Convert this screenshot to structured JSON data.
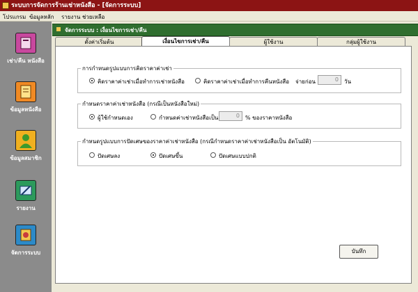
{
  "window": {
    "title": "ระบบการจัดการร้านเช่าหนังสือ - [จัดการระบบ]"
  },
  "menu": [
    "โปรแกรม",
    "ข้อมูลหลัก",
    "รายงาน",
    "ช่วยเหลือ"
  ],
  "sidebar": {
    "items": [
      {
        "label": "เช่า/คืน หนังสือ",
        "icon": "book-return-icon"
      },
      {
        "label": "ข้อมูลหนังสือ",
        "icon": "book-icon"
      },
      {
        "label": "ข้อมูลสมาชิก",
        "icon": "user-icon"
      },
      {
        "label": "รายงาน",
        "icon": "report-icon"
      },
      {
        "label": "จัดการระบบ",
        "icon": "settings-icon"
      }
    ]
  },
  "panel": {
    "title": "จัดการระบบ : เงื่อนไขการเช่า/คืน"
  },
  "tabs": [
    {
      "label": "ตั้งค่าเริ่มต้น",
      "active": false
    },
    {
      "label": "เงื่อนไขการเช่า/คืน",
      "active": true
    },
    {
      "label": "ผู้ใช้งาน",
      "active": false
    },
    {
      "label": "กลุ่มผู้ใช้งาน",
      "active": false
    }
  ],
  "groups": {
    "pricing": {
      "legend": "การกำหนดรูปแบบการคิดราคาค่าเช่า",
      "opt1": "คิดราคาค่าเช่าเมื่อทำการเช่าหนังสือ",
      "opt2": "คิดราคาค่าเช่าเมื่อทำการคืนหนังสือ",
      "prefix": "จ่ายก่อน",
      "days": "0",
      "suffix": "วัน",
      "selected": 1
    },
    "rent": {
      "legend": "กำหนดราคาค่าเช่าหนังสือ (กรณีเป็นหนังสือใหม่)",
      "opt1": "ผู้ใช้กำหนดเอง",
      "opt2": "กำหนดค่าเช่าหนังสือเป็น",
      "percent": "0",
      "suffix": "% ของราคาหนังสือ",
      "selected": 1
    },
    "rounding": {
      "legend": "กำหนดรูปแบบการปัดเศษของราคาค่าเช่าหนังสือ (กรณีกำหนดราคาค่าเช่าหนังสือเป็น อัตโนมัติ)",
      "opt1": "ปัดเศษลง",
      "opt2": "ปัดเศษขึ้น",
      "opt3": "ปัดเศษแบบปกติ",
      "selected": 2
    }
  },
  "save_label": "บันทึก",
  "colors": {
    "titlebar": "#8c1414",
    "panelbar": "#2f6e2f",
    "sidebar": "#8b8b8b"
  }
}
